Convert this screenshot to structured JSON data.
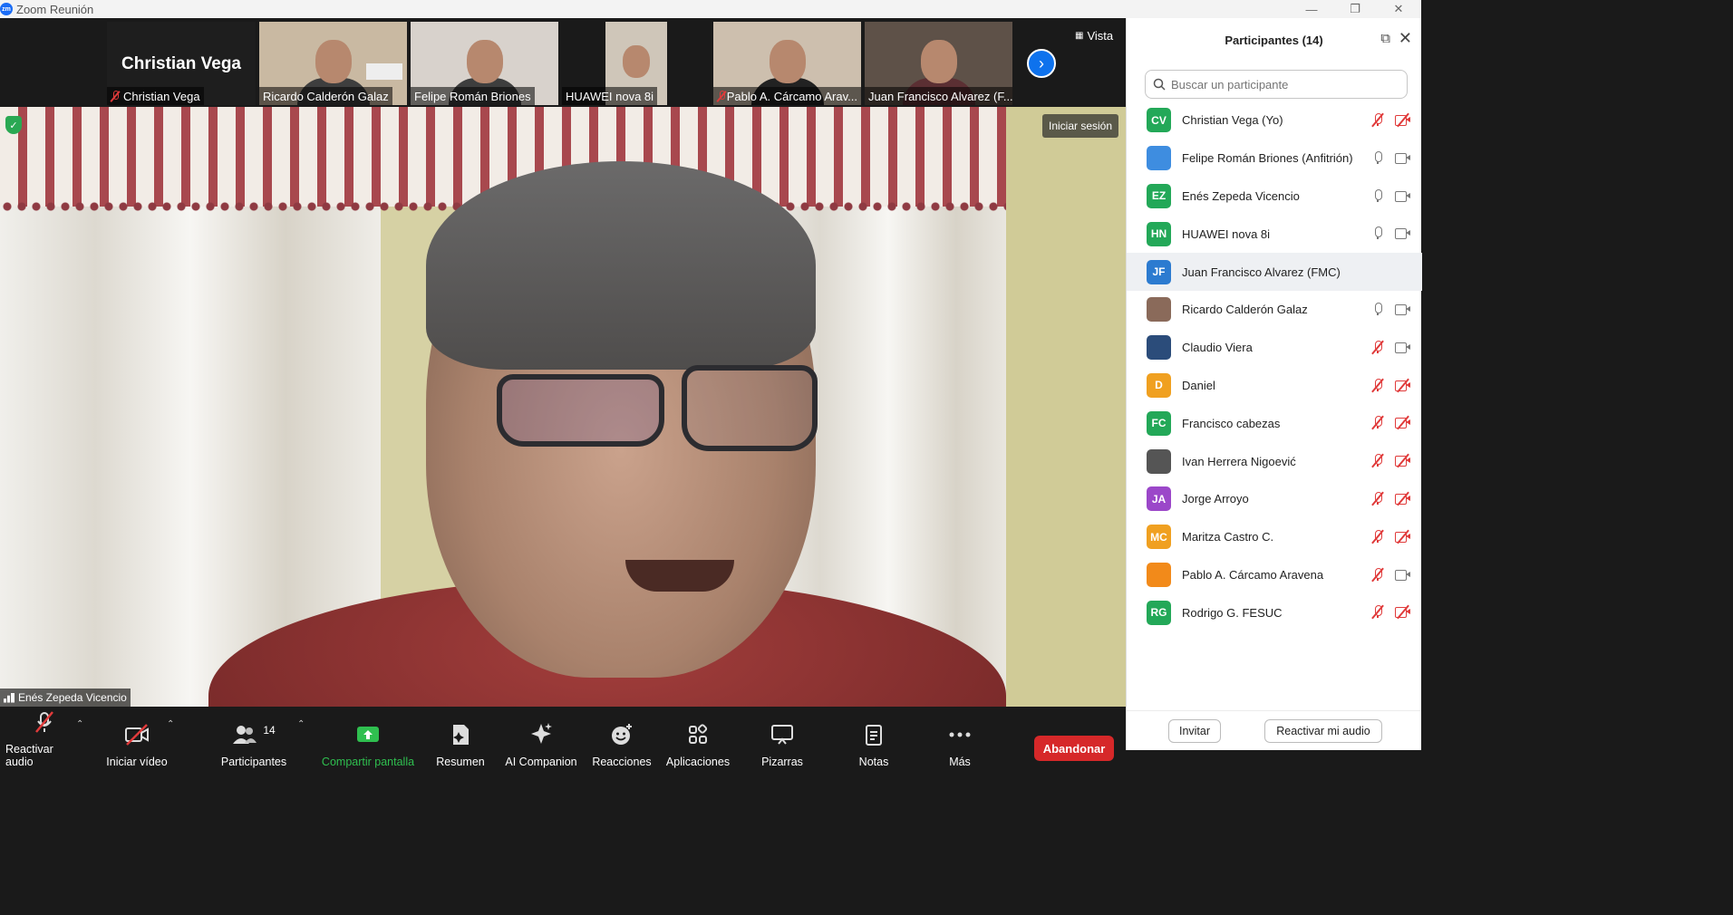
{
  "window": {
    "app_icon": "zm",
    "title": "Zoom Reunión"
  },
  "strip": {
    "tiles": [
      {
        "name": "Christian Vega",
        "bigname": "Christian Vega",
        "muted": true
      },
      {
        "name": "Ricardo Calderón Galaz",
        "muted": false
      },
      {
        "name": "Felipe Román Briones",
        "muted": false
      },
      {
        "name": "HUAWEI nova 8i",
        "muted": false
      },
      {
        "name": "Pablo A. Cárcamo Arav...",
        "muted": true
      },
      {
        "name": "Juan Francisco Alvarez (F...",
        "muted": false
      }
    ],
    "view_label": "Vista",
    "next_icon": "chevron-right-icon"
  },
  "main": {
    "speaker_name": "Enés Zepeda Vicencio",
    "signin_label": "Iniciar sesión",
    "security_icon": "shield-check-icon"
  },
  "toolbar": {
    "audio_label": "Reactivar audio",
    "video_label": "Iniciar vídeo",
    "participants_label": "Participantes",
    "participants_count": "14",
    "share_label": "Compartir pantalla",
    "summary_label": "Resumen",
    "ai_label": "AI Companion",
    "reactions_label": "Reacciones",
    "apps_label": "Aplicaciones",
    "whiteboards_label": "Pizarras",
    "notes_label": "Notas",
    "more_label": "Más",
    "leave_label": "Abandonar",
    "share_color": "#2fbf4f",
    "leave_color": "#d62829"
  },
  "panel": {
    "title": "Participantes (14)",
    "search_placeholder": "Buscar un participante",
    "invite_label": "Invitar",
    "unmute_label": "Reactivar mi audio",
    "participants": [
      {
        "initials": "CV",
        "name": "Christian Vega (Yo)",
        "color": "#23a858",
        "mic": "off",
        "cam": "off"
      },
      {
        "initials": "",
        "name": "Felipe Román Briones (Anfitrión)",
        "color": "#3e8de0",
        "mic": "on",
        "cam": "on"
      },
      {
        "initials": "EZ",
        "name": "Enés Zepeda Vicencio",
        "color": "#23a858",
        "mic": "on",
        "cam": "on"
      },
      {
        "initials": "HN",
        "name": "HUAWEI nova 8i",
        "color": "#23a858",
        "mic": "on",
        "cam": "on"
      },
      {
        "initials": "JF",
        "name": "Juan Francisco Alvarez (FMC)",
        "color": "#2c7bd0",
        "mic": "",
        "cam": ""
      },
      {
        "initials": "",
        "name": "Ricardo Calderón Galaz",
        "color": "#8a6a5a",
        "mic": "on",
        "cam": "on"
      },
      {
        "initials": "",
        "name": "Claudio Viera",
        "color": "#2b4c7a",
        "mic": "off",
        "cam": "on"
      },
      {
        "initials": "D",
        "name": "Daniel",
        "color": "#f0a020",
        "mic": "off",
        "cam": "off"
      },
      {
        "initials": "FC",
        "name": "Francisco cabezas",
        "color": "#23a858",
        "mic": "off",
        "cam": "off"
      },
      {
        "initials": "",
        "name": "Ivan Herrera Nigoević",
        "color": "#555555",
        "mic": "off",
        "cam": "off"
      },
      {
        "initials": "JA",
        "name": "Jorge Arroyo",
        "color": "#9b47c9",
        "mic": "off",
        "cam": "off"
      },
      {
        "initials": "MC",
        "name": "Maritza Castro C.",
        "color": "#f0a020",
        "mic": "off",
        "cam": "off"
      },
      {
        "initials": "",
        "name": "Pablo A. Cárcamo Aravena",
        "color": "#f28a1a",
        "mic": "off",
        "cam": "on"
      },
      {
        "initials": "RG",
        "name": "Rodrigo G. FESUC",
        "color": "#23a858",
        "mic": "off",
        "cam": "off"
      }
    ]
  }
}
